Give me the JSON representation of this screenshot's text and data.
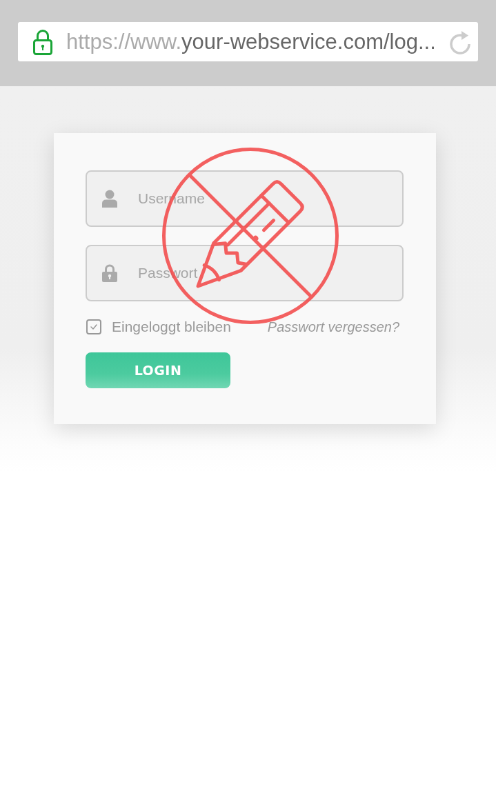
{
  "browser": {
    "secure": true,
    "url_start": "https://www.",
    "url_rest": "your-webservice.com/log..."
  },
  "login_form": {
    "fields": [
      {
        "kind": "username",
        "placeholder": "Username"
      },
      {
        "kind": "password",
        "placeholder": "Passwort"
      }
    ],
    "remember": {
      "label": "Eingeloggt bleiben",
      "checked": true
    },
    "forgot_link": "Passwort vergessen?",
    "submit": "LOGIN"
  }
}
